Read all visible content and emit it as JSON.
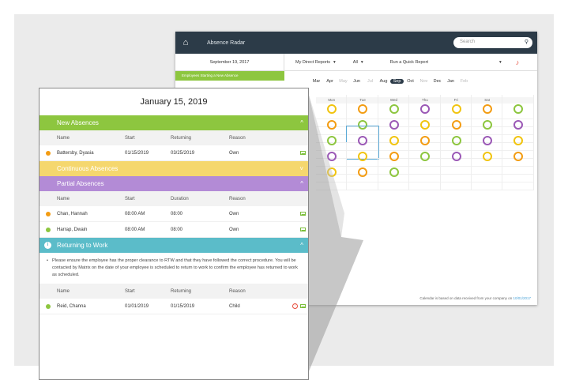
{
  "calendar": {
    "app_title": "Absence Radar",
    "search_placeholder": "Search",
    "date": "September 19, 2017",
    "filter_reports": "My Direct Reports",
    "filter_all": "All",
    "quick_report": "Run a Quick Report",
    "side_banner": "Employees Starting a New Absence",
    "months": [
      "Mar",
      "Apr",
      "May",
      "Jun",
      "Jul",
      "Aug",
      "Sep",
      "Oct",
      "Nov",
      "Dec",
      "Jan",
      "Feb"
    ],
    "selected_month": "Sep",
    "days": [
      "Mon",
      "Tue",
      "Wed",
      "Thu",
      "Fri",
      "Sat"
    ],
    "footer_text": "Calendar is based on data received from your company on",
    "footer_date": "10/01/2017"
  },
  "panel": {
    "date": "January 15, 2019",
    "new_absences": {
      "title": "New Absences",
      "columns": [
        "Name",
        "Start",
        "Returning",
        "Reason"
      ],
      "rows": [
        {
          "name": "Battersby, Dyasia",
          "start": "01/15/2019",
          "returning": "03/25/2019",
          "reason": "Own",
          "status": "orange"
        }
      ]
    },
    "continuous": {
      "title": "Continuous Absences"
    },
    "partial_absences": {
      "title": "Partial Absences",
      "columns": [
        "Name",
        "Start",
        "Duration",
        "Reason"
      ],
      "rows": [
        {
          "name": "Chan, Hannah",
          "start": "08:00 AM",
          "duration": "08:00",
          "reason": "Own",
          "status": "orange"
        },
        {
          "name": "Harrap, Dwain",
          "start": "08:00 AM",
          "duration": "08:00",
          "reason": "Own",
          "status": "green"
        }
      ]
    },
    "returning": {
      "title": "Returning to Work",
      "note": "Please ensure the employee has the proper clearance to RTW and that they have followed the correct procedure. You will be contacted by Matrix on the date of your employee is scheduled to return to work to confirm the employee has returned to work as scheduled.",
      "columns": [
        "Name",
        "Start",
        "Returning",
        "Reason"
      ],
      "rows": [
        {
          "name": "Reid, Channa",
          "start": "01/01/2019",
          "returning": "01/15/2019",
          "reason": "Child",
          "status": "green"
        }
      ]
    }
  }
}
